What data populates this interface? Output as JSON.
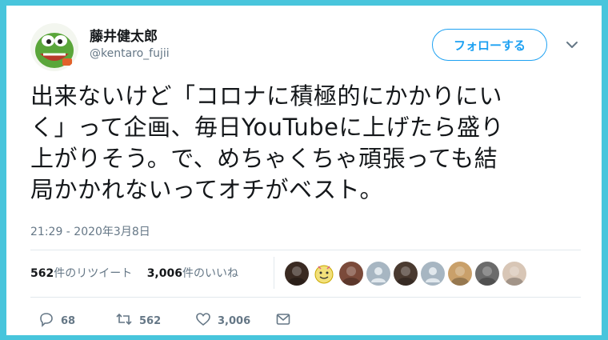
{
  "user": {
    "name": "藤井健太郎",
    "handle": "@kentaro_fujii"
  },
  "follow_label": "フォローする",
  "tweet": {
    "lines": [
      "出来ないけど「コロナに積極的にかかりにい",
      "く」って企画、毎日YouTubeに上げたら盛り",
      "上がりそう。で、めちゃくちゃ頑張っても結",
      "局かかれないってオチがベスト。"
    ],
    "timestamp": "21:29 - 2020年3月8日"
  },
  "stats": {
    "retweets_count": "562",
    "retweets_suffix": "件のリツイート",
    "likes_count": "3,006",
    "likes_suffix": "件のいいね"
  },
  "liker_avatars": [
    {
      "color": "#3a2a22",
      "icon": "avatar-photo"
    },
    {
      "color": "#f2e07a",
      "icon": "avatar-emoji"
    },
    {
      "color": "#7b4a3a",
      "icon": "avatar-photo"
    },
    {
      "color": "#a7b6c2",
      "icon": "default-avatar"
    },
    {
      "color": "#4a3a30",
      "icon": "avatar-photo"
    },
    {
      "color": "#a7b6c2",
      "icon": "default-avatar"
    },
    {
      "color": "#c9a06a",
      "icon": "avatar-photo"
    },
    {
      "color": "#6b6b6b",
      "icon": "avatar-photo"
    },
    {
      "color": "#d8c6b6",
      "icon": "avatar-photo"
    }
  ],
  "actions": {
    "reply": "68",
    "retweet": "562",
    "like": "3,006"
  },
  "colors": {
    "frame": "#48c5dc",
    "accent": "#1da1f2",
    "muted": "#657786"
  }
}
